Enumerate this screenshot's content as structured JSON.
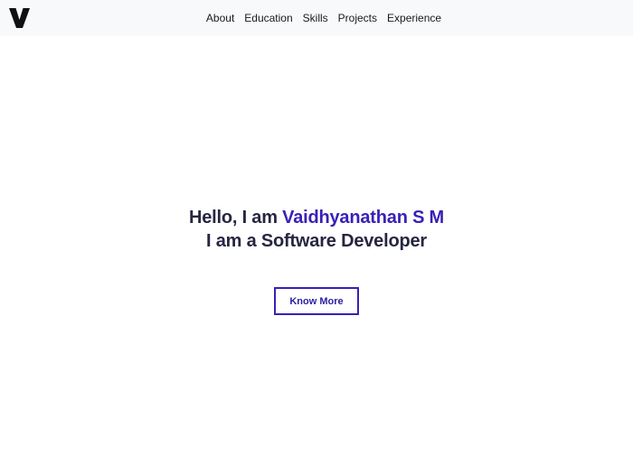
{
  "brand": {
    "logo_letter": "V",
    "logo_color": "#111111"
  },
  "nav": {
    "items": [
      {
        "label": "About"
      },
      {
        "label": "Education"
      },
      {
        "label": "Skills"
      },
      {
        "label": "Projects"
      },
      {
        "label": "Experience"
      }
    ]
  },
  "hero": {
    "greeting": "Hello, I am ",
    "name": "Vaidhyanathan S M",
    "role_line": "I am a Software Developer",
    "cta_label": "Know More"
  },
  "colors": {
    "accent": "#3a20b8",
    "heading": "#262642",
    "navbar_bg": "#f8f9fa"
  }
}
